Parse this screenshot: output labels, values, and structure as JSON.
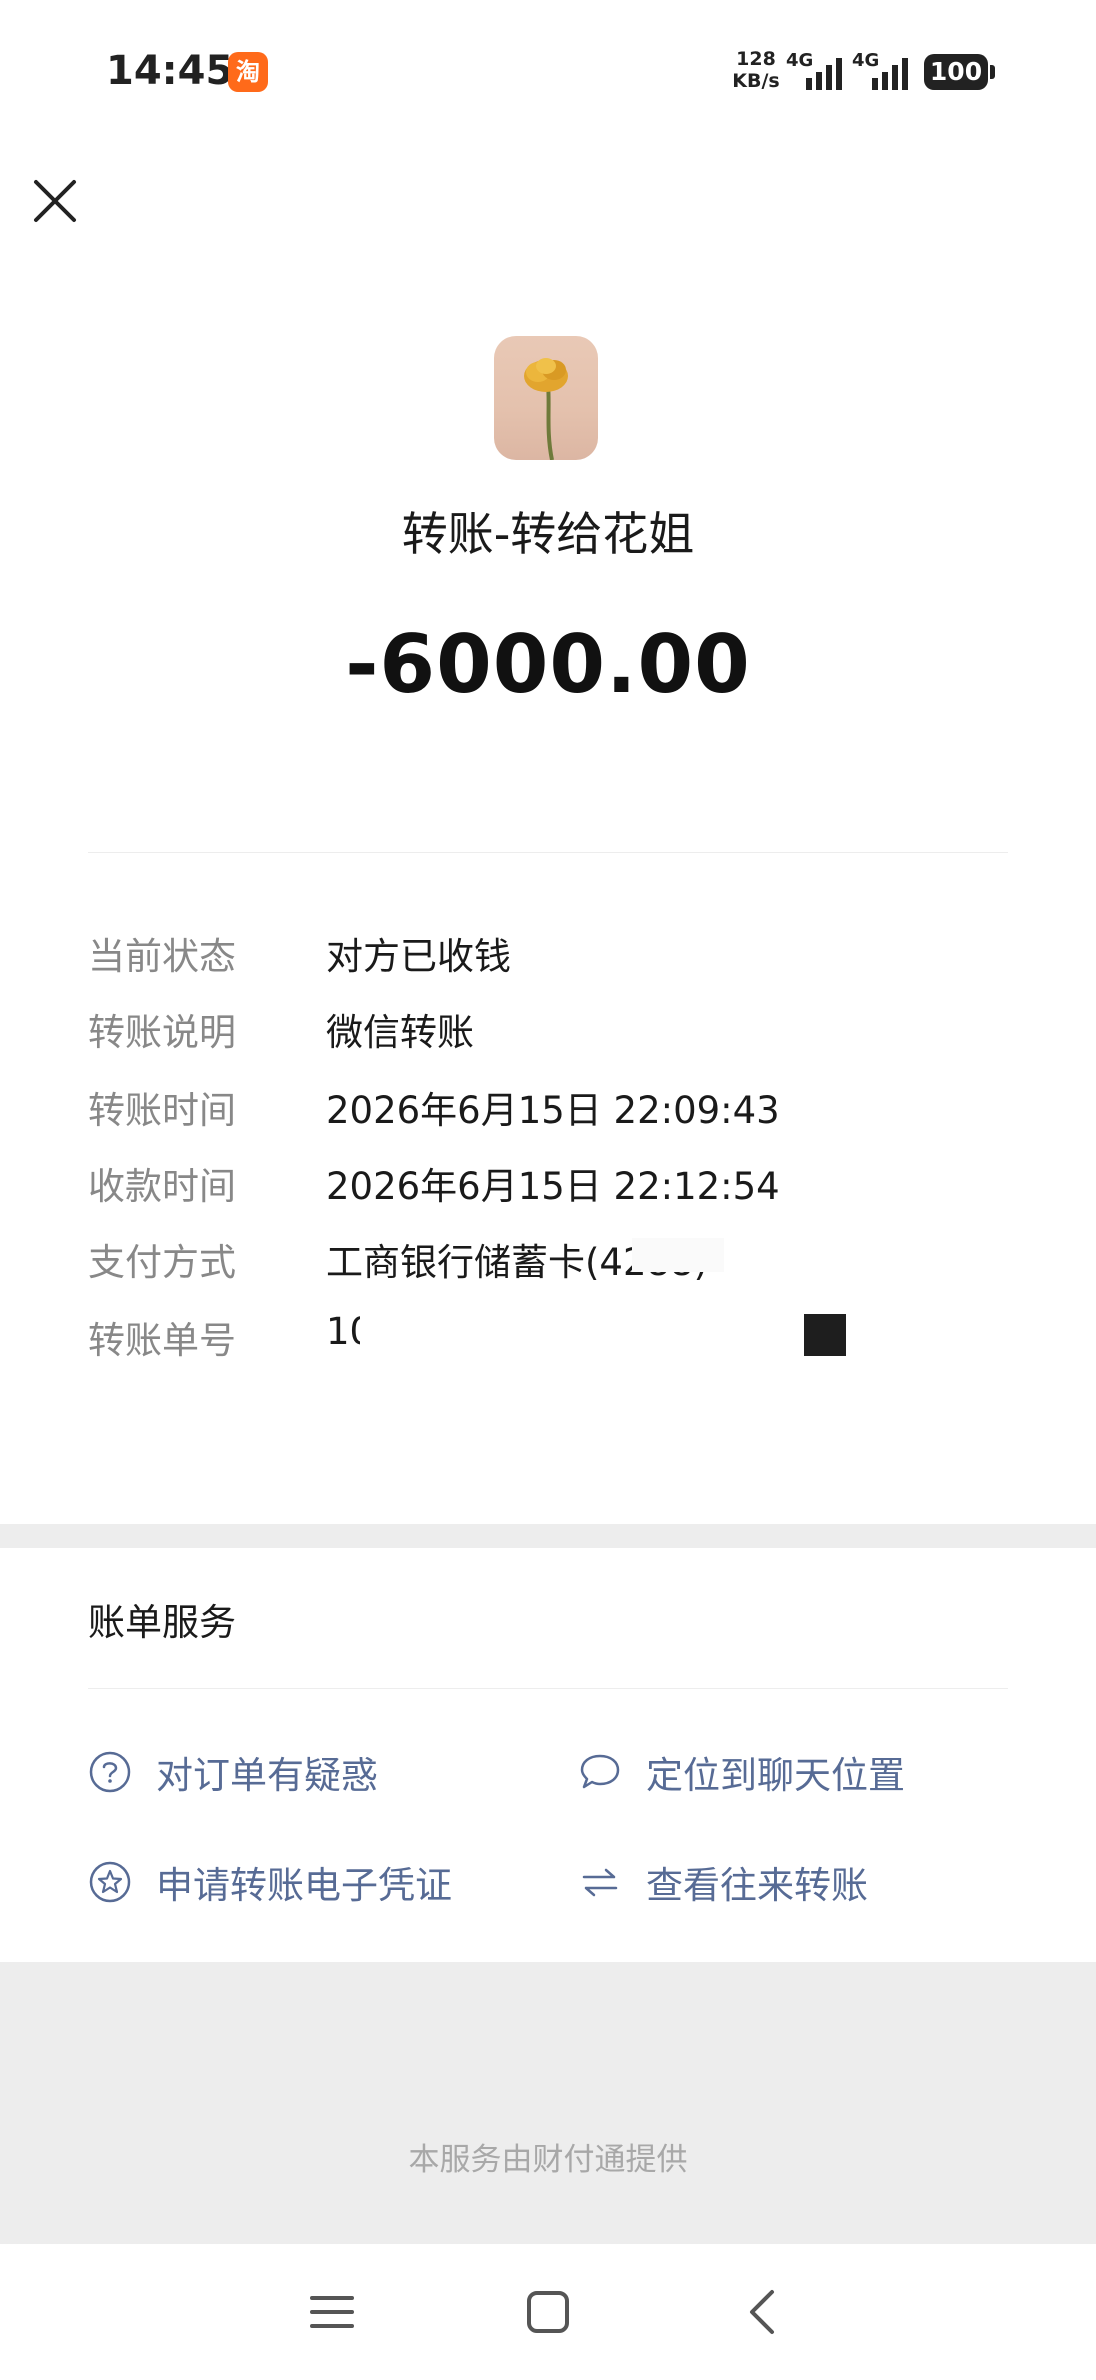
{
  "status_bar": {
    "time": "14:45",
    "app_icon": "淘",
    "speed_value": "128",
    "speed_unit": "KB/s",
    "signal_1": "4G",
    "signal_2": "4G",
    "battery": "100"
  },
  "header": {
    "close_icon": "close-icon"
  },
  "transfer": {
    "title": "转账-转给花姐",
    "amount": "-6000.00"
  },
  "details": [
    {
      "label": "当前状态",
      "value": "对方已收钱"
    },
    {
      "label": "转账说明",
      "value": "微信转账"
    },
    {
      "label": "转账时间",
      "value": "2026年6月15日 22:09:43"
    },
    {
      "label": "收款时间",
      "value": "2026年6月15日 22:12:54"
    },
    {
      "label": "支付方式",
      "value": "工商银行储蓄卡(4288)"
    },
    {
      "label": "转账单号",
      "value": "100"
    }
  ],
  "bill_service": {
    "title": "账单服务",
    "items": [
      {
        "label": "对订单有疑惑",
        "icon": "question-circle-icon"
      },
      {
        "label": "定位到聊天位置",
        "icon": "chat-bubble-icon"
      },
      {
        "label": "申请转账电子凭证",
        "icon": "star-badge-icon"
      },
      {
        "label": "查看往来转账",
        "icon": "exchange-arrows-icon"
      }
    ]
  },
  "footer": {
    "provider": "本服务由财付通提供"
  },
  "colors": {
    "link": "#576b95",
    "label_gray": "#888888",
    "background_gray": "#ededed"
  }
}
